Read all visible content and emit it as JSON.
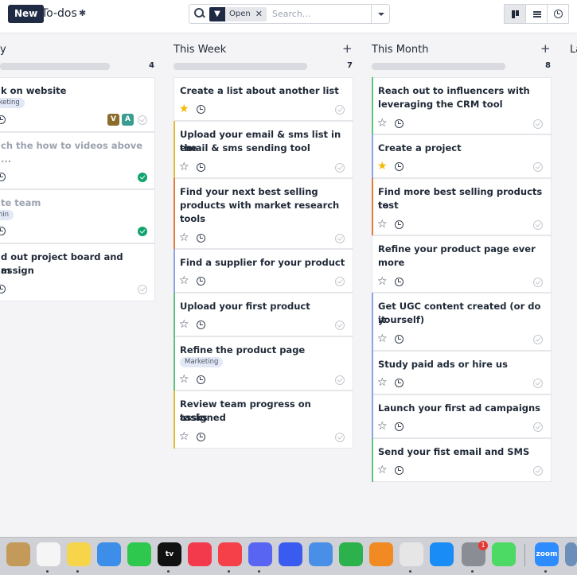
{
  "header": {
    "new_label": "New",
    "title": "To-dos",
    "filter_label": "Open",
    "search_placeholder": "Search..."
  },
  "columns": [
    {
      "title": "y",
      "count": "4",
      "accent": ""
    },
    {
      "title": "This Week",
      "count": "7"
    },
    {
      "title": "This Month",
      "count": "8"
    },
    {
      "title": "La"
    }
  ],
  "today_cards": [
    {
      "title_l1": "k on website",
      "tag": "rketing",
      "avatars": [
        "V",
        "A"
      ]
    },
    {
      "title_l1": "ch the how to videos above",
      "title_l2": "..."
    },
    {
      "title_l1": "te team",
      "tag": "min"
    },
    {
      "title_l1": "d out project board and assign",
      "title_l2": "m"
    }
  ],
  "week_cards": [
    {
      "title_l1": "Create a list about another list"
    },
    {
      "title_l1": "Upload your email & sms list in the",
      "title_l2": "email & sms sending tool"
    },
    {
      "title_l1": "Find your next best selling",
      "title_l2": "products with market research",
      "title_l3": "tools"
    },
    {
      "title_l1": "Find a supplier for your product"
    },
    {
      "title_l1": "Upload your first product"
    },
    {
      "title_l1": "Refine the product page",
      "tag": "Marketing"
    },
    {
      "title_l1": "Review team progress on assigned",
      "title_l2": "tasks"
    }
  ],
  "month_cards": [
    {
      "title_l1": "Reach out to influencers with",
      "title_l2": "leveraging the CRM tool"
    },
    {
      "title_l1": "Create a project"
    },
    {
      "title_l1": "Find more best selling products to",
      "title_l2": "test"
    },
    {
      "title_l1": "Refine your product page ever",
      "title_l2": "more"
    },
    {
      "title_l1": "Get UGC content created (or do it",
      "title_l2": "yourself)"
    },
    {
      "title_l1": "Study paid ads or hire us"
    },
    {
      "title_l1": "Launch your first ad campaigns"
    },
    {
      "title_l1": "Send your fist email and SMS"
    }
  ],
  "dock": {
    "apps": [
      "finder-app",
      "reminders-app",
      "notes-app",
      "keynote-app",
      "whatsapp-app",
      "tv-app",
      "music-app",
      "news-app",
      "discord-app",
      "settings-app",
      "slack-app",
      "numbers-app",
      "pages-app",
      "chrome-app",
      "appstore-app",
      "system-prefs-app",
      "messages-app",
      "zoom-app",
      "preview-app"
    ],
    "tv_label": "tv",
    "zoom_label": "zoom",
    "badge": "1"
  },
  "colors": {
    "accent_yellow": "#e8b93a",
    "accent_green": "#5fc27e",
    "accent_orange": "#e07b3a",
    "accent_blue": "#8ea2e6",
    "accent_red": "#e06666",
    "done_green": "#10a36b",
    "star_gold": "#f5b800"
  }
}
